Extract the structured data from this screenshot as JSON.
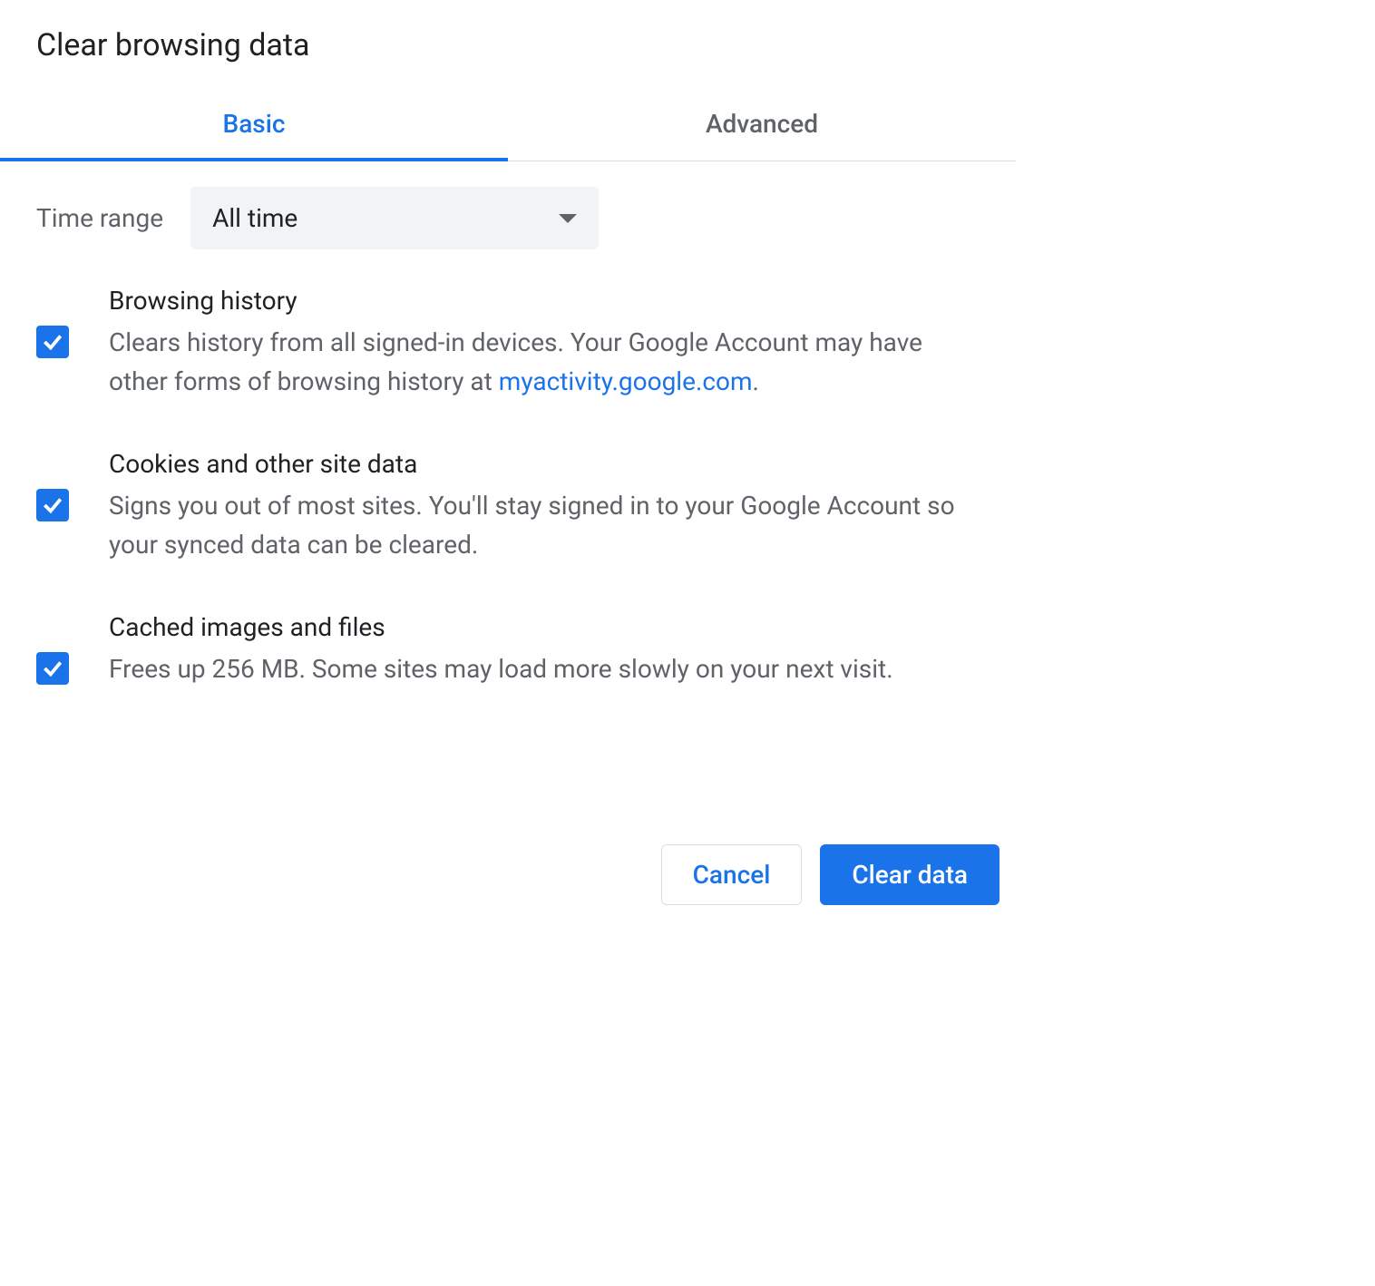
{
  "dialog": {
    "title": "Clear browsing data",
    "tabs": {
      "basic": "Basic",
      "advanced": "Advanced",
      "active": "basic"
    },
    "time_range": {
      "label": "Time range",
      "selected": "All time"
    },
    "options": [
      {
        "checked": true,
        "title": "Browsing history",
        "desc_pre": "Clears history from all signed-in devices. Your Google Account may have other forms of browsing history at ",
        "link_text": "myactivity.google.com",
        "desc_post": "."
      },
      {
        "checked": true,
        "title": "Cookies and other site data",
        "desc": "Signs you out of most sites. You'll stay signed in to your Google Account so your synced data can be cleared."
      },
      {
        "checked": true,
        "title": "Cached images and files",
        "desc": "Frees up 256 MB. Some sites may load more slowly on your next visit."
      }
    ],
    "buttons": {
      "cancel": "Cancel",
      "clear": "Clear data"
    }
  }
}
